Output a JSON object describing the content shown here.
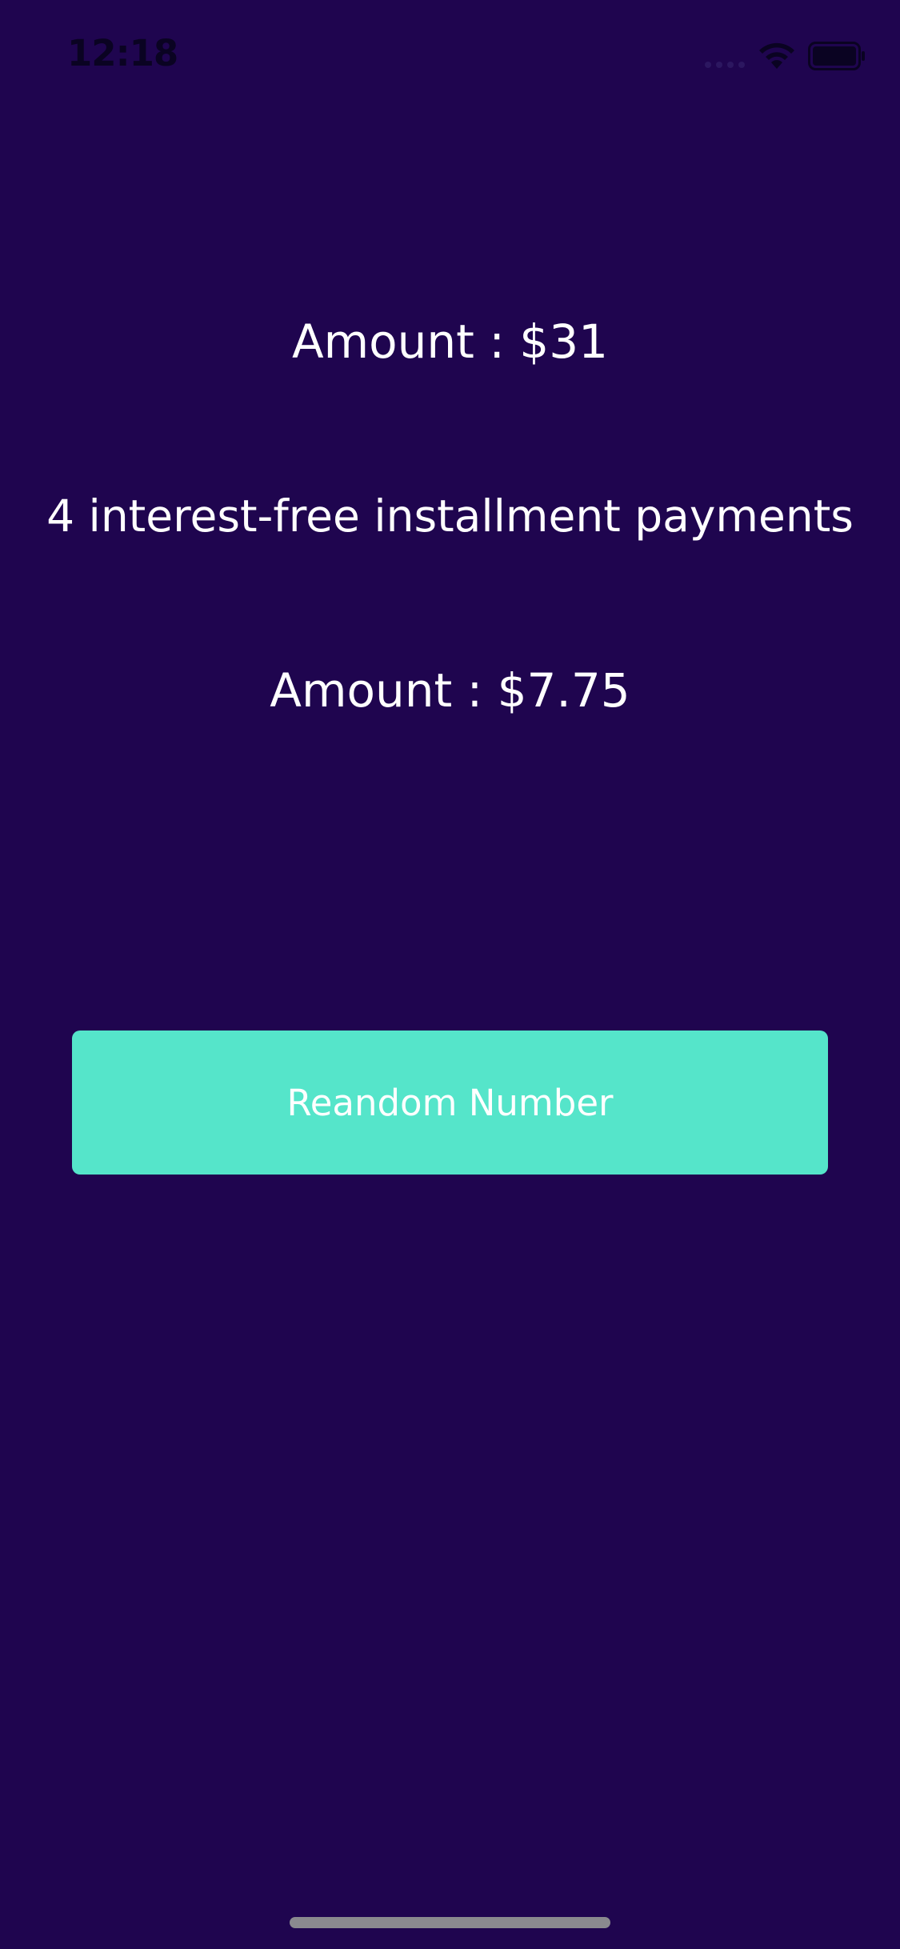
{
  "status_bar": {
    "time": "12:18",
    "icons": [
      "cellular-signal-icon",
      "wifi-icon",
      "battery-icon"
    ]
  },
  "main": {
    "amount_total": "Amount : $31",
    "installment_text": "4 interest-free installment payments",
    "amount_installment": "Amount : $7.75",
    "button_label": "Reandom Number"
  },
  "colors": {
    "background": "#1f054f",
    "button": "#55e5ca",
    "text": "#ffffff",
    "status_icons": "#0a0322"
  }
}
